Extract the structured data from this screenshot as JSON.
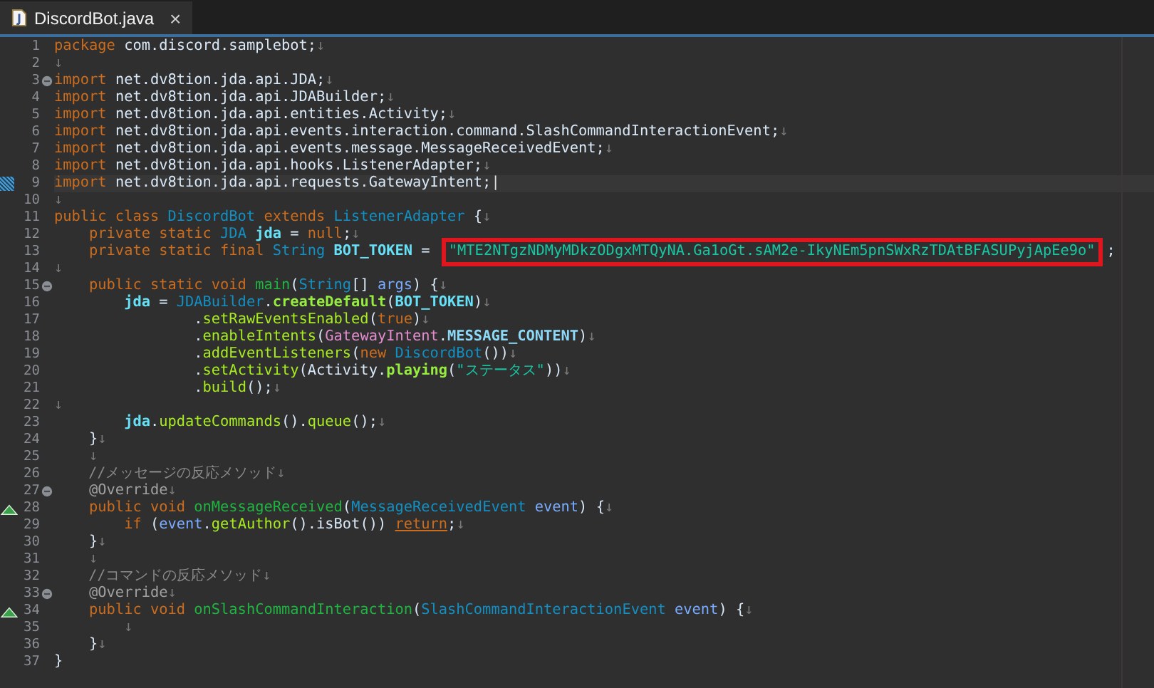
{
  "tab": {
    "title": "DiscordBot.java",
    "close": "×",
    "selected": true
  },
  "lines": [
    {
      "number": "1",
      "kind": "plain",
      "tokens": [
        {
          "text": "package",
          "kind": "keyword"
        },
        {
          "text": " com.discord.samplebot;",
          "kind": "plain"
        },
        {
          "text": "↓",
          "kind": "whitespace"
        }
      ]
    },
    {
      "number": "2",
      "kind": "plain",
      "tokens": [
        {
          "text": "↓",
          "kind": "whitespace"
        }
      ]
    },
    {
      "number": "3",
      "kind": "fold",
      "tokens": [
        {
          "text": "import",
          "kind": "keyword"
        },
        {
          "text": " net.dv8tion.jda.api.JDA;",
          "kind": "plain"
        },
        {
          "text": "↓",
          "kind": "whitespace"
        }
      ]
    },
    {
      "number": "4",
      "kind": "plain",
      "tokens": [
        {
          "text": "import",
          "kind": "keyword"
        },
        {
          "text": " net.dv8tion.jda.api.JDABuilder;",
          "kind": "plain"
        },
        {
          "text": "↓",
          "kind": "whitespace"
        }
      ]
    },
    {
      "number": "5",
      "kind": "plain",
      "tokens": [
        {
          "text": "import",
          "kind": "keyword"
        },
        {
          "text": " net.dv8tion.jda.api.entities.Activity;",
          "kind": "plain"
        },
        {
          "text": "↓",
          "kind": "whitespace"
        }
      ]
    },
    {
      "number": "6",
      "kind": "plain",
      "tokens": [
        {
          "text": "import",
          "kind": "keyword"
        },
        {
          "text": " net.dv8tion.jda.api.events.interaction.command.SlashCommandInteractionEvent;",
          "kind": "plain"
        },
        {
          "text": "↓",
          "kind": "whitespace"
        }
      ]
    },
    {
      "number": "7",
      "kind": "plain",
      "tokens": [
        {
          "text": "import",
          "kind": "keyword"
        },
        {
          "text": " net.dv8tion.jda.api.events.message.MessageReceivedEvent;",
          "kind": "plain"
        },
        {
          "text": "↓",
          "kind": "whitespace"
        }
      ]
    },
    {
      "number": "8",
      "kind": "plain",
      "tokens": [
        {
          "text": "import",
          "kind": "keyword"
        },
        {
          "text": " net.dv8tion.jda.api.hooks.ListenerAdapter;",
          "kind": "plain"
        },
        {
          "text": "↓",
          "kind": "whitespace"
        }
      ]
    },
    {
      "number": "9",
      "kind": "change",
      "current": true,
      "tokens": [
        {
          "text": "import",
          "kind": "keyword"
        },
        {
          "text": " net.dv8tion.jda.api.requests.GatewayIntent;",
          "kind": "plain"
        },
        {
          "text": "|",
          "kind": "cursor"
        }
      ]
    },
    {
      "number": "10",
      "kind": "plain",
      "tokens": [
        {
          "text": "↓",
          "kind": "whitespace"
        }
      ]
    },
    {
      "number": "11",
      "kind": "plain",
      "tokens": [
        {
          "text": "public class ",
          "kind": "keyword"
        },
        {
          "text": "DiscordBot",
          "kind": "type"
        },
        {
          "text": " extends ",
          "kind": "keyword"
        },
        {
          "text": "ListenerAdapter",
          "kind": "type"
        },
        {
          "text": " {",
          "kind": "plain"
        },
        {
          "text": "↓",
          "kind": "whitespace"
        }
      ]
    },
    {
      "number": "12",
      "kind": "plain",
      "tokens": [
        {
          "text": "    private static ",
          "kind": "keyword"
        },
        {
          "text": "JDA",
          "kind": "type"
        },
        {
          "text": " jda",
          "kind": "field"
        },
        {
          "text": " = ",
          "kind": "plain"
        },
        {
          "text": "null",
          "kind": "keyword"
        },
        {
          "text": ";",
          "kind": "plain"
        },
        {
          "text": "↓",
          "kind": "whitespace"
        }
      ]
    },
    {
      "number": "13",
      "kind": "plain",
      "tokens": [
        {
          "text": "    private static final ",
          "kind": "keyword"
        },
        {
          "text": "String",
          "kind": "type"
        },
        {
          "text": " BOT_TOKEN",
          "kind": "field"
        },
        {
          "text": " = ",
          "kind": "plain"
        },
        {
          "text": "\"MTE2NTgzNDMyMDkzODgxMTQyNA.Ga1oGt.sAM2e-IkyNEm5pnSWxRzTDAtBFASUPyjApEe9o\"",
          "kind": "string",
          "highlighted": true
        },
        {
          "text": ";",
          "kind": "plain"
        }
      ]
    },
    {
      "number": "14",
      "kind": "plain",
      "tokens": [
        {
          "text": "↓",
          "kind": "whitespace"
        }
      ]
    },
    {
      "number": "15",
      "kind": "fold",
      "tokens": [
        {
          "text": "    public static void ",
          "kind": "keyword"
        },
        {
          "text": "main",
          "kind": "method"
        },
        {
          "text": "(",
          "kind": "plain"
        },
        {
          "text": "String",
          "kind": "type"
        },
        {
          "text": "[] ",
          "kind": "plain"
        },
        {
          "text": "args",
          "kind": "param"
        },
        {
          "text": ") {",
          "kind": "plain"
        },
        {
          "text": "↓",
          "kind": "whitespace"
        }
      ]
    },
    {
      "number": "16",
      "kind": "plain",
      "tokens": [
        {
          "text": "        jda",
          "kind": "field"
        },
        {
          "text": " = ",
          "kind": "plain"
        },
        {
          "text": "JDABuilder",
          "kind": "type"
        },
        {
          "text": ".",
          "kind": "plain"
        },
        {
          "text": "createDefault",
          "kind": "static"
        },
        {
          "text": "(",
          "kind": "plain"
        },
        {
          "text": "BOT_TOKEN",
          "kind": "field"
        },
        {
          "text": ")",
          "kind": "plain"
        },
        {
          "text": "↓",
          "kind": "whitespace"
        }
      ]
    },
    {
      "number": "17",
      "kind": "plain",
      "tokens": [
        {
          "text": "                .",
          "kind": "plain"
        },
        {
          "text": "setRawEventsEnabled",
          "kind": "call"
        },
        {
          "text": "(",
          "kind": "plain"
        },
        {
          "text": "true",
          "kind": "keyword"
        },
        {
          "text": ")",
          "kind": "plain"
        },
        {
          "text": "↓",
          "kind": "whitespace"
        }
      ]
    },
    {
      "number": "18",
      "kind": "plain",
      "tokens": [
        {
          "text": "                .",
          "kind": "plain"
        },
        {
          "text": "enableIntents",
          "kind": "call"
        },
        {
          "text": "(",
          "kind": "plain"
        },
        {
          "text": "GatewayIntent",
          "kind": "enum"
        },
        {
          "text": ".",
          "kind": "plain"
        },
        {
          "text": "MESSAGE_CONTENT",
          "kind": "constant"
        },
        {
          "text": ")",
          "kind": "plain"
        },
        {
          "text": "↓",
          "kind": "whitespace"
        }
      ]
    },
    {
      "number": "19",
      "kind": "plain",
      "tokens": [
        {
          "text": "                .",
          "kind": "plain"
        },
        {
          "text": "addEventListeners",
          "kind": "call"
        },
        {
          "text": "(",
          "kind": "plain"
        },
        {
          "text": "new ",
          "kind": "keyword"
        },
        {
          "text": "DiscordBot",
          "kind": "type"
        },
        {
          "text": "())",
          "kind": "plain"
        },
        {
          "text": "↓",
          "kind": "whitespace"
        }
      ]
    },
    {
      "number": "20",
      "kind": "plain",
      "tokens": [
        {
          "text": "                .",
          "kind": "plain"
        },
        {
          "text": "setActivity",
          "kind": "call"
        },
        {
          "text": "(Activity.",
          "kind": "plain"
        },
        {
          "text": "playing",
          "kind": "static"
        },
        {
          "text": "(",
          "kind": "plain"
        },
        {
          "text": "\"ステータス\"",
          "kind": "string"
        },
        {
          "text": "))",
          "kind": "plain"
        },
        {
          "text": "↓",
          "kind": "whitespace"
        }
      ]
    },
    {
      "number": "21",
      "kind": "plain",
      "tokens": [
        {
          "text": "                .",
          "kind": "plain"
        },
        {
          "text": "build",
          "kind": "call"
        },
        {
          "text": "();",
          "kind": "plain"
        },
        {
          "text": "↓",
          "kind": "whitespace"
        }
      ]
    },
    {
      "number": "22",
      "kind": "plain",
      "tokens": [
        {
          "text": "↓",
          "kind": "whitespace"
        }
      ]
    },
    {
      "number": "23",
      "kind": "plain",
      "tokens": [
        {
          "text": "        jda",
          "kind": "field"
        },
        {
          "text": ".",
          "kind": "plain"
        },
        {
          "text": "updateCommands",
          "kind": "call"
        },
        {
          "text": "().",
          "kind": "plain"
        },
        {
          "text": "queue",
          "kind": "call"
        },
        {
          "text": "();",
          "kind": "plain"
        },
        {
          "text": "↓",
          "kind": "whitespace"
        }
      ]
    },
    {
      "number": "24",
      "kind": "plain",
      "tokens": [
        {
          "text": "    }",
          "kind": "plain"
        },
        {
          "text": "↓",
          "kind": "whitespace"
        }
      ]
    },
    {
      "number": "25",
      "kind": "plain",
      "tokens": [
        {
          "text": "    ↓",
          "kind": "whitespace"
        }
      ]
    },
    {
      "number": "26",
      "kind": "plain",
      "tokens": [
        {
          "text": "    //メッセージの反応メソッド",
          "kind": "comment"
        },
        {
          "text": "↓",
          "kind": "whitespace"
        }
      ]
    },
    {
      "number": "27",
      "kind": "fold",
      "tokens": [
        {
          "text": "    @Override",
          "kind": "annotation"
        },
        {
          "text": "↓",
          "kind": "whitespace"
        }
      ]
    },
    {
      "number": "28",
      "kind": "override",
      "tokens": [
        {
          "text": "    public void ",
          "kind": "keyword"
        },
        {
          "text": "onMessageReceived",
          "kind": "method"
        },
        {
          "text": "(",
          "kind": "plain"
        },
        {
          "text": "MessageReceivedEvent",
          "kind": "type"
        },
        {
          "text": " event",
          "kind": "param"
        },
        {
          "text": ") {",
          "kind": "plain"
        },
        {
          "text": "↓",
          "kind": "whitespace"
        }
      ]
    },
    {
      "number": "29",
      "kind": "plain",
      "tokens": [
        {
          "text": "        if ",
          "kind": "keyword"
        },
        {
          "text": "(",
          "kind": "plain"
        },
        {
          "text": "event",
          "kind": "param"
        },
        {
          "text": ".",
          "kind": "plain"
        },
        {
          "text": "getAuthor",
          "kind": "call"
        },
        {
          "text": "().isBot()) ",
          "kind": "plain"
        },
        {
          "text": "return",
          "kind": "link"
        },
        {
          "text": ";",
          "kind": "plain"
        },
        {
          "text": "↓",
          "kind": "whitespace"
        }
      ]
    },
    {
      "number": "30",
      "kind": "plain",
      "tokens": [
        {
          "text": "    }",
          "kind": "plain"
        },
        {
          "text": "↓",
          "kind": "whitespace"
        }
      ]
    },
    {
      "number": "31",
      "kind": "plain",
      "tokens": [
        {
          "text": "    ↓",
          "kind": "whitespace"
        }
      ]
    },
    {
      "number": "32",
      "kind": "plain",
      "tokens": [
        {
          "text": "    //コマンドの反応メソッド",
          "kind": "comment"
        },
        {
          "text": "↓",
          "kind": "whitespace"
        }
      ]
    },
    {
      "number": "33",
      "kind": "fold",
      "tokens": [
        {
          "text": "    @Override",
          "kind": "annotation"
        },
        {
          "text": "↓",
          "kind": "whitespace"
        }
      ]
    },
    {
      "number": "34",
      "kind": "override",
      "tokens": [
        {
          "text": "    public void ",
          "kind": "keyword"
        },
        {
          "text": "onSlashCommandInteraction",
          "kind": "method"
        },
        {
          "text": "(",
          "kind": "plain"
        },
        {
          "text": "SlashCommandInteractionEvent",
          "kind": "type"
        },
        {
          "text": " event",
          "kind": "param"
        },
        {
          "text": ") {",
          "kind": "plain"
        },
        {
          "text": "↓",
          "kind": "whitespace"
        }
      ]
    },
    {
      "number": "35",
      "kind": "plain",
      "tokens": [
        {
          "text": "        ↓",
          "kind": "whitespace"
        }
      ]
    },
    {
      "number": "36",
      "kind": "plain",
      "tokens": [
        {
          "text": "    }",
          "kind": "plain"
        },
        {
          "text": "↓",
          "kind": "whitespace"
        }
      ]
    },
    {
      "number": "37",
      "kind": "plain",
      "tokens": [
        {
          "text": "}",
          "kind": "plain"
        }
      ]
    }
  ]
}
